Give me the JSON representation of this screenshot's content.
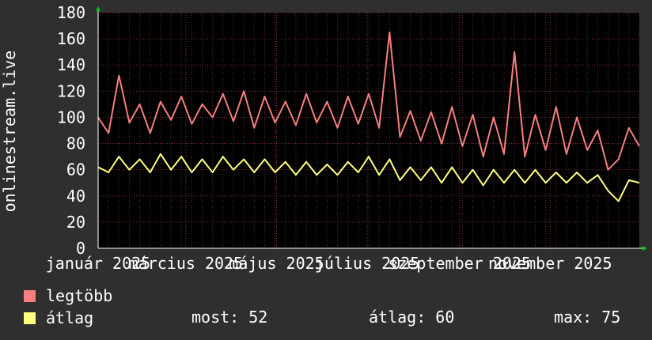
{
  "chart_data": {
    "type": "line",
    "ylabel": "onlinestream.live",
    "ylim": [
      0,
      180
    ],
    "yticks": [
      0,
      20,
      40,
      60,
      80,
      100,
      120,
      140,
      160,
      180
    ],
    "xlim": [
      "2025-01-01",
      "2025-12-31"
    ],
    "xticks": [
      {
        "date": "2025-01-01",
        "label": "január 2025"
      },
      {
        "date": "2025-03-01",
        "label": "március 2025"
      },
      {
        "date": "2025-05-01",
        "label": "május 2025"
      },
      {
        "date": "2025-07-01",
        "label": "július 2025"
      },
      {
        "date": "2025-09-01",
        "label": "szeptember 2025"
      },
      {
        "date": "2025-11-01",
        "label": "november 2025"
      }
    ],
    "grid": true,
    "series": [
      {
        "name": "legtöbb",
        "color": "#f77f7f",
        "points": [
          [
            "2025-01-01",
            100
          ],
          [
            "2025-01-08",
            88
          ],
          [
            "2025-01-15",
            132
          ],
          [
            "2025-01-22",
            96
          ],
          [
            "2025-01-29",
            110
          ],
          [
            "2025-02-05",
            88
          ],
          [
            "2025-02-12",
            112
          ],
          [
            "2025-02-19",
            98
          ],
          [
            "2025-02-26",
            116
          ],
          [
            "2025-03-05",
            95
          ],
          [
            "2025-03-12",
            110
          ],
          [
            "2025-03-19",
            100
          ],
          [
            "2025-03-26",
            118
          ],
          [
            "2025-04-02",
            97
          ],
          [
            "2025-04-09",
            120
          ],
          [
            "2025-04-16",
            92
          ],
          [
            "2025-04-23",
            116
          ],
          [
            "2025-04-30",
            96
          ],
          [
            "2025-05-07",
            112
          ],
          [
            "2025-05-14",
            94
          ],
          [
            "2025-05-21",
            118
          ],
          [
            "2025-05-28",
            96
          ],
          [
            "2025-06-04",
            112
          ],
          [
            "2025-06-11",
            92
          ],
          [
            "2025-06-18",
            116
          ],
          [
            "2025-06-25",
            95
          ],
          [
            "2025-07-02",
            118
          ],
          [
            "2025-07-09",
            92
          ],
          [
            "2025-07-16",
            165
          ],
          [
            "2025-07-23",
            85
          ],
          [
            "2025-07-30",
            105
          ],
          [
            "2025-08-06",
            82
          ],
          [
            "2025-08-13",
            104
          ],
          [
            "2025-08-20",
            80
          ],
          [
            "2025-08-27",
            108
          ],
          [
            "2025-09-03",
            78
          ],
          [
            "2025-09-10",
            102
          ],
          [
            "2025-09-17",
            70
          ],
          [
            "2025-09-24",
            100
          ],
          [
            "2025-10-01",
            72
          ],
          [
            "2025-10-08",
            150
          ],
          [
            "2025-10-15",
            70
          ],
          [
            "2025-10-22",
            102
          ],
          [
            "2025-10-29",
            75
          ],
          [
            "2025-11-05",
            108
          ],
          [
            "2025-11-12",
            72
          ],
          [
            "2025-11-19",
            100
          ],
          [
            "2025-11-26",
            75
          ],
          [
            "2025-12-03",
            90
          ],
          [
            "2025-12-10",
            60
          ],
          [
            "2025-12-17",
            68
          ],
          [
            "2025-12-24",
            92
          ],
          [
            "2025-12-31",
            78
          ]
        ]
      },
      {
        "name": "átlag",
        "color": "#ffff7f",
        "points": [
          [
            "2025-01-01",
            62
          ],
          [
            "2025-01-08",
            58
          ],
          [
            "2025-01-15",
            70
          ],
          [
            "2025-01-22",
            60
          ],
          [
            "2025-01-29",
            68
          ],
          [
            "2025-02-05",
            58
          ],
          [
            "2025-02-12",
            72
          ],
          [
            "2025-02-19",
            60
          ],
          [
            "2025-02-26",
            70
          ],
          [
            "2025-03-05",
            58
          ],
          [
            "2025-03-12",
            68
          ],
          [
            "2025-03-19",
            58
          ],
          [
            "2025-03-26",
            70
          ],
          [
            "2025-04-02",
            60
          ],
          [
            "2025-04-09",
            68
          ],
          [
            "2025-04-16",
            58
          ],
          [
            "2025-04-23",
            68
          ],
          [
            "2025-04-30",
            58
          ],
          [
            "2025-05-07",
            66
          ],
          [
            "2025-05-14",
            56
          ],
          [
            "2025-05-21",
            66
          ],
          [
            "2025-05-28",
            56
          ],
          [
            "2025-06-04",
            64
          ],
          [
            "2025-06-11",
            56
          ],
          [
            "2025-06-18",
            66
          ],
          [
            "2025-06-25",
            58
          ],
          [
            "2025-07-02",
            70
          ],
          [
            "2025-07-09",
            56
          ],
          [
            "2025-07-16",
            68
          ],
          [
            "2025-07-23",
            52
          ],
          [
            "2025-07-30",
            62
          ],
          [
            "2025-08-06",
            52
          ],
          [
            "2025-08-13",
            62
          ],
          [
            "2025-08-20",
            50
          ],
          [
            "2025-08-27",
            62
          ],
          [
            "2025-09-03",
            50
          ],
          [
            "2025-09-10",
            60
          ],
          [
            "2025-09-17",
            48
          ],
          [
            "2025-09-24",
            60
          ],
          [
            "2025-10-01",
            50
          ],
          [
            "2025-10-08",
            60
          ],
          [
            "2025-10-15",
            50
          ],
          [
            "2025-10-22",
            60
          ],
          [
            "2025-10-29",
            50
          ],
          [
            "2025-11-05",
            58
          ],
          [
            "2025-11-12",
            50
          ],
          [
            "2025-11-19",
            58
          ],
          [
            "2025-11-26",
            50
          ],
          [
            "2025-12-03",
            56
          ],
          [
            "2025-12-10",
            44
          ],
          [
            "2025-12-17",
            36
          ],
          [
            "2025-12-24",
            52
          ],
          [
            "2025-12-31",
            50
          ]
        ]
      }
    ]
  },
  "legend": [
    {
      "label": "legtöbb",
      "color": "#f77f7f"
    },
    {
      "label": "átlag",
      "color": "#ffff7f"
    }
  ],
  "stats": {
    "now": "most: 52",
    "avg": "átlag: 60",
    "max": "max: 75"
  }
}
